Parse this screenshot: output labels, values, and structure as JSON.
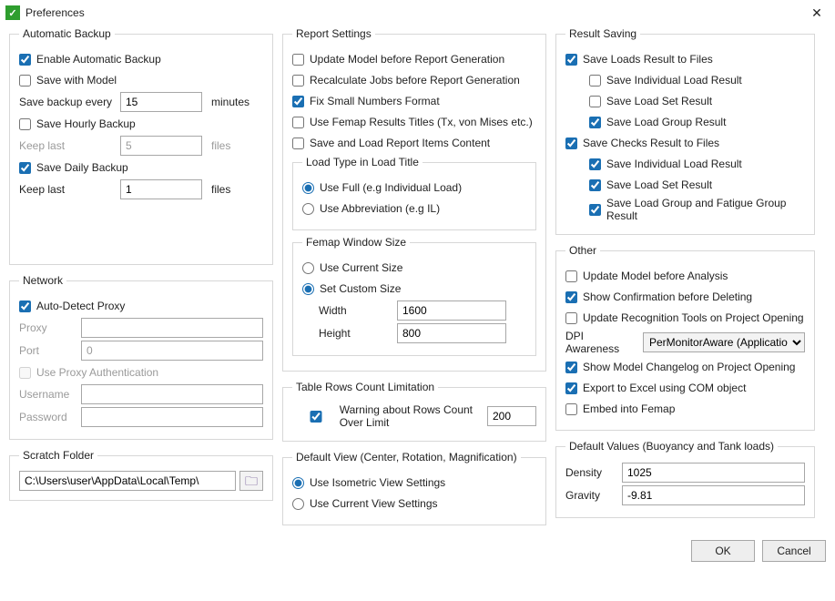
{
  "window": {
    "title": "Preferences"
  },
  "automatic_backup": {
    "legend": "Automatic Backup",
    "enable": {
      "label": "Enable Automatic Backup",
      "checked": true
    },
    "save_with_model": {
      "label": "Save with Model",
      "checked": false
    },
    "interval": {
      "label": "Save backup every",
      "value": "15",
      "suffix": "minutes"
    },
    "hourly": {
      "label": "Save Hourly Backup",
      "checked": false
    },
    "hourly_keep": {
      "label": "Keep last",
      "value": "5",
      "suffix": "files"
    },
    "daily": {
      "label": "Save Daily Backup",
      "checked": true
    },
    "daily_keep": {
      "label": "Keep last",
      "value": "1",
      "suffix": "files"
    }
  },
  "network": {
    "legend": "Network",
    "auto_detect": {
      "label": "Auto-Detect Proxy",
      "checked": true
    },
    "proxy_label": "Proxy",
    "proxy_value": "",
    "port_label": "Port",
    "port_value": "0",
    "use_auth": {
      "label": "Use Proxy Authentication",
      "checked": false
    },
    "user_label": "Username",
    "user_value": "",
    "pass_label": "Password",
    "pass_value": ""
  },
  "scratch": {
    "legend": "Scratch Folder",
    "path": "C:\\Users\\user\\AppData\\Local\\Temp\\"
  },
  "report": {
    "legend": "Report Settings",
    "update_model": {
      "label": "Update Model before Report Generation",
      "checked": false
    },
    "recalc_jobs": {
      "label": "Recalculate Jobs before Report Generation",
      "checked": false
    },
    "fix_small": {
      "label": "Fix Small Numbers Format",
      "checked": true
    },
    "use_femap_titles": {
      "label": "Use Femap Results Titles (Tx, von Mises etc.)",
      "checked": false
    },
    "save_load_items": {
      "label": "Save and Load Report Items Content",
      "checked": false
    },
    "load_type": {
      "legend": "Load Type in Load Title",
      "full": "Use Full (e.g Individual Load)",
      "abbr": "Use Abbreviation (e.g IL)"
    },
    "femap_win": {
      "legend": "Femap Window Size",
      "current": "Use Current Size",
      "custom": "Set Custom Size",
      "width_label": "Width",
      "width_value": "1600",
      "height_label": "Height",
      "height_value": "800"
    }
  },
  "rows_limit": {
    "legend": "Table Rows Count Limitation",
    "warning": {
      "label": "Warning about Rows Count Over Limit",
      "checked": true,
      "value": "200"
    }
  },
  "default_view": {
    "legend": "Default View (Center, Rotation, Magnification)",
    "iso": "Use Isometric View Settings",
    "current": "Use Current View Settings"
  },
  "result_saving": {
    "legend": "Result Saving",
    "loads_to_files": {
      "label": "Save Loads Result to Files",
      "checked": true
    },
    "loads_indiv": {
      "label": "Save Individual Load Result",
      "checked": false
    },
    "loads_set": {
      "label": "Save Load Set Result",
      "checked": false
    },
    "loads_group": {
      "label": "Save Load Group Result",
      "checked": true
    },
    "checks_to_files": {
      "label": "Save Checks Result to Files",
      "checked": true
    },
    "checks_indiv": {
      "label": "Save Individual Load Result",
      "checked": true
    },
    "checks_set": {
      "label": "Save Load Set Result",
      "checked": true
    },
    "checks_group": {
      "label": "Save Load Group and Fatigue Group Result",
      "checked": true
    }
  },
  "other": {
    "legend": "Other",
    "update_before_analysis": {
      "label": "Update Model before Analysis",
      "checked": false
    },
    "confirm_delete": {
      "label": "Show Confirmation before Deleting",
      "checked": true
    },
    "update_recog": {
      "label": "Update Recognition Tools on Project Opening",
      "checked": false
    },
    "dpi_label": "DPI Awareness",
    "dpi_value": "PerMonitorAware (Applicatio",
    "show_changelog": {
      "label": "Show Model Changelog on Project Opening",
      "checked": true
    },
    "export_com": {
      "label": "Export to Excel using COM object",
      "checked": true
    },
    "embed_femap": {
      "label": "Embed into Femap",
      "checked": false
    }
  },
  "default_values": {
    "legend": "Default Values (Buoyancy and Tank loads)",
    "density_label": "Density",
    "density_value": "1025",
    "gravity_label": "Gravity",
    "gravity_value": "-9.81"
  },
  "buttons": {
    "ok": "OK",
    "cancel": "Cancel"
  }
}
